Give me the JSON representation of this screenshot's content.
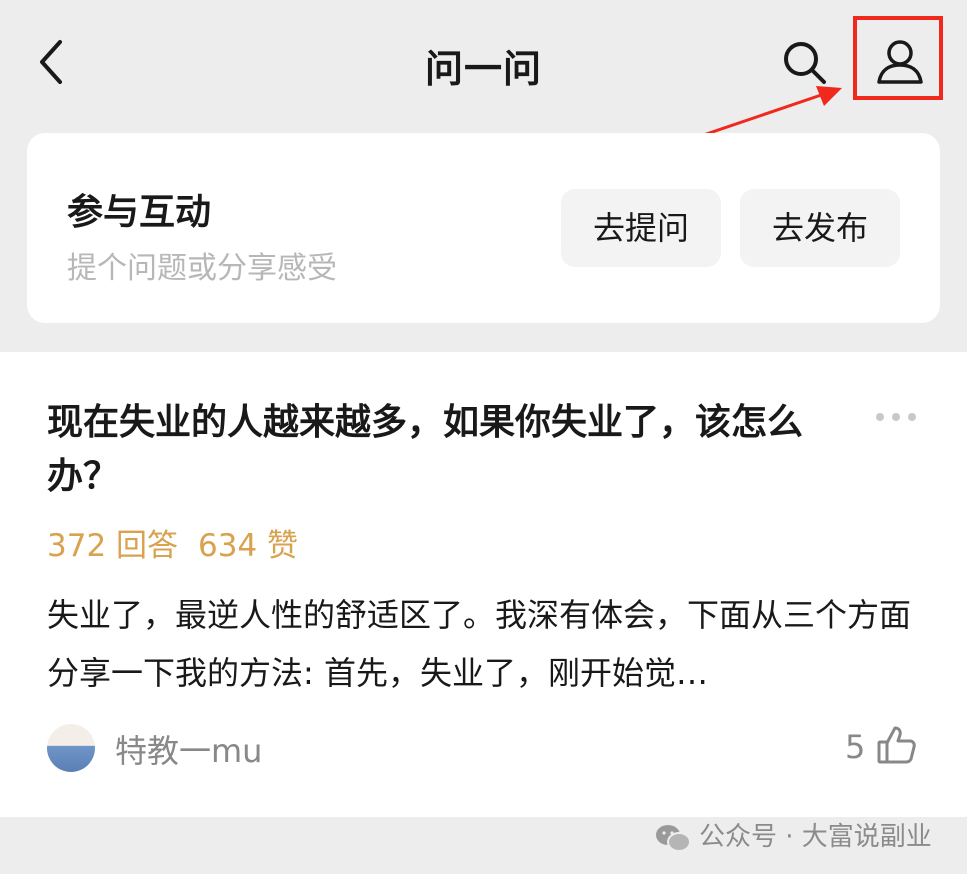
{
  "header": {
    "title": "问一问"
  },
  "interact_card": {
    "title": "参与互动",
    "subtitle": "提个问题或分享感受",
    "ask_label": "去提问",
    "post_label": "去发布"
  },
  "question": {
    "title": "现在失业的人越来越多，如果你失业了，该怎么办？",
    "answers": "372 回答",
    "likes": "634 赞",
    "excerpt": "失业了，最逆人性的舒适区了。我深有体会，下面从三个方面分享一下我的方法: 首先，失业了，刚开始觉…",
    "author": "特教一mu",
    "like_count": "5"
  },
  "watermark": {
    "text": "公众号 · 大富说副业"
  },
  "colors": {
    "highlight_border": "#f0281e",
    "stats_text": "#d8a24f",
    "page_bg": "#ededed"
  }
}
